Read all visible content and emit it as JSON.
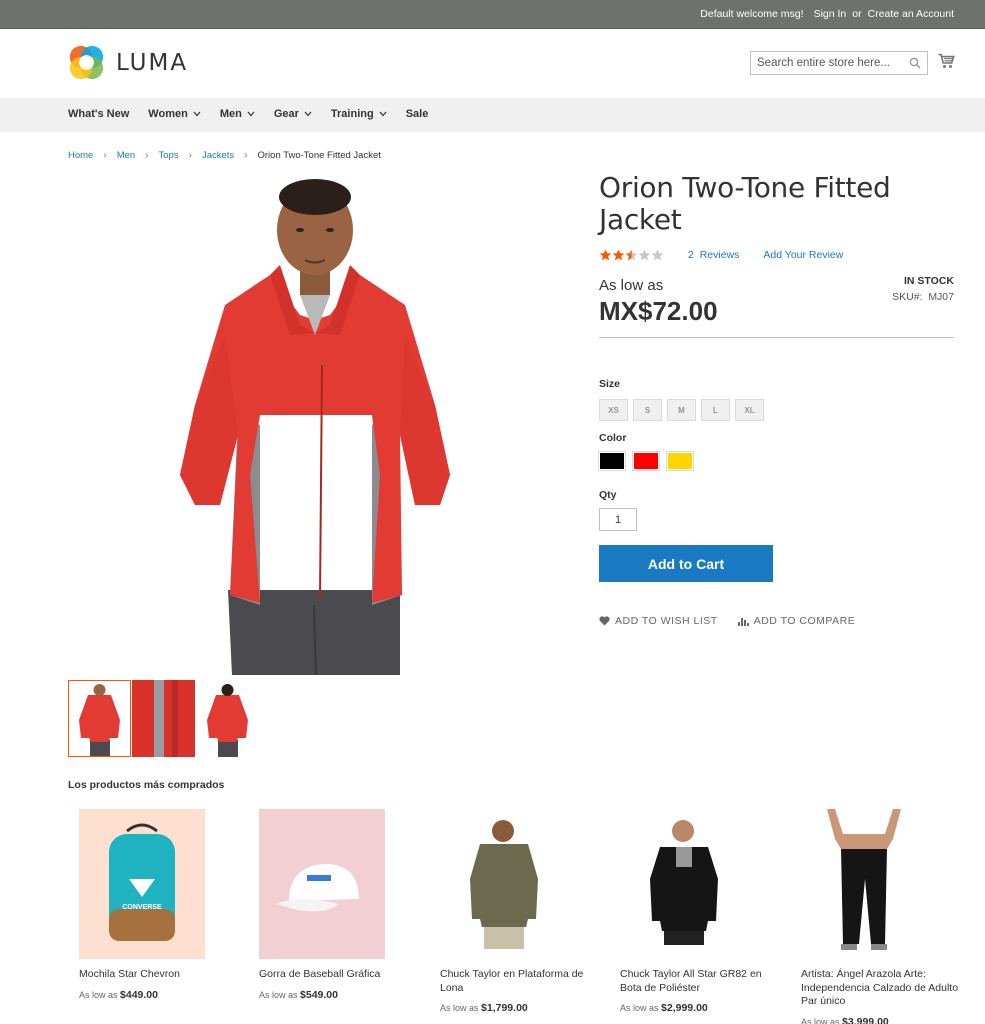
{
  "header": {
    "welcome": "Default welcome msg!",
    "sign_in": "Sign In",
    "or": "or",
    "create_account": "Create an Account",
    "logo_text": "LUMA",
    "search_placeholder": "Search entire store here..."
  },
  "nav": {
    "items": [
      {
        "label": "What's New",
        "dropdown": false
      },
      {
        "label": "Women",
        "dropdown": true
      },
      {
        "label": "Men",
        "dropdown": true
      },
      {
        "label": "Gear",
        "dropdown": true
      },
      {
        "label": "Training",
        "dropdown": true
      },
      {
        "label": "Sale",
        "dropdown": false
      }
    ]
  },
  "breadcrumb": {
    "items": [
      "Home",
      "Men",
      "Tops",
      "Jackets"
    ],
    "current": "Orion Two-Tone Fitted Jacket"
  },
  "product": {
    "title": "Orion Two-Tone Fitted Jacket",
    "rating_fraction": 0.5,
    "reviews_count": "2",
    "reviews_label": "Reviews",
    "add_review": "Add Your Review",
    "as_low_as": "As low as",
    "price": "MX$72.00",
    "stock": "IN STOCK",
    "sku_label": "SKU#:",
    "sku": "MJ07",
    "size_label": "Size",
    "sizes": [
      "XS",
      "S",
      "M",
      "L",
      "XL"
    ],
    "color_label": "Color",
    "colors": [
      "#000000",
      "#ff0000",
      "#ffd500"
    ],
    "qty_label": "Qty",
    "qty": "1",
    "add_to_cart": "Add to Cart",
    "wish_list": "ADD TO WISH LIST",
    "compare": "ADD TO COMPARE"
  },
  "related": {
    "title": "Los productos más comprados",
    "as_low_as": "As low as",
    "items": [
      {
        "name": "Mochila Star Chevron",
        "price": "$449.00"
      },
      {
        "name": "Gorra de Baseball Gráfica",
        "price": "$549.00"
      },
      {
        "name": "Chuck Taylor en Plataforma de Lona",
        "price": "$1,799.00"
      },
      {
        "name": "Chuck Taylor All Star GR82 en Bota de Poliéster",
        "price": "$2,999.00"
      },
      {
        "name": "Artista: Ángel Arazola Arte: Independencia Calzado de Adulto Par único",
        "price": "$3,999.00"
      }
    ]
  }
}
